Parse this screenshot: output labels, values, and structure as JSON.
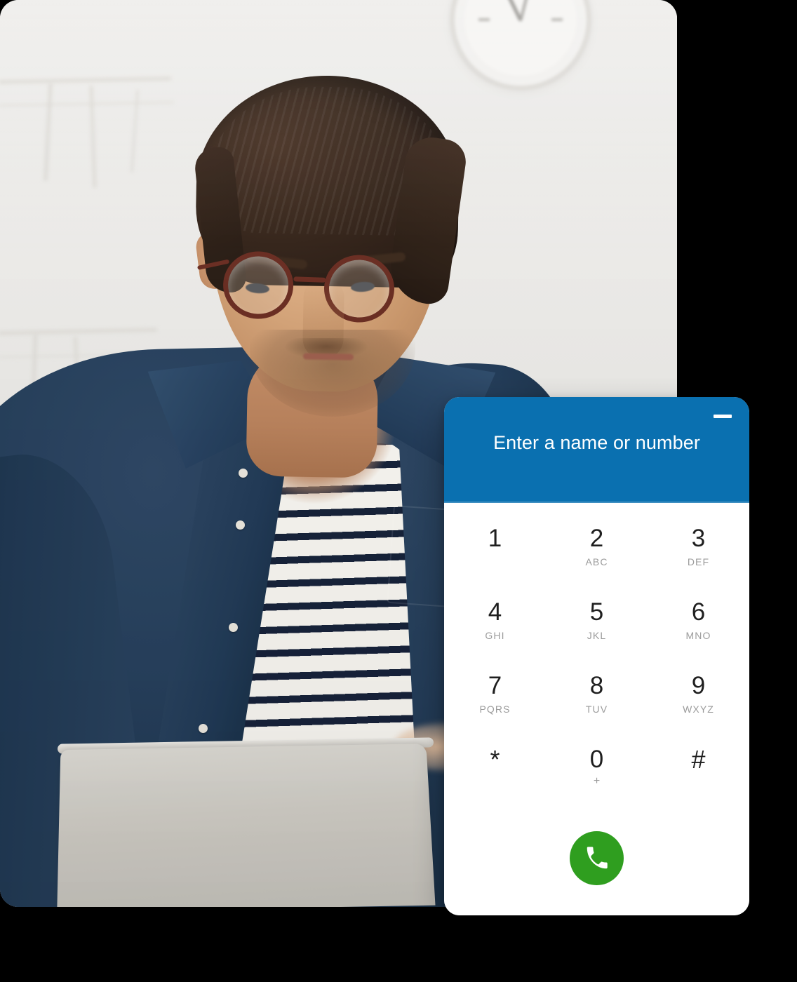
{
  "photo": {
    "alt_description": "Man with glasses in denim shirt and striped t-shirt working at a laptop",
    "background_clock": "wall-clock"
  },
  "dialpad": {
    "header": {
      "title": "Enter a name or number",
      "minimize_label": "Minimize",
      "bg_color": "#0a70b0",
      "text_color": "#ffffff"
    },
    "keys": [
      {
        "digit": "1",
        "letters": ""
      },
      {
        "digit": "2",
        "letters": "ABC"
      },
      {
        "digit": "3",
        "letters": "DEF"
      },
      {
        "digit": "4",
        "letters": "GHI"
      },
      {
        "digit": "5",
        "letters": "JKL"
      },
      {
        "digit": "6",
        "letters": "MNO"
      },
      {
        "digit": "7",
        "letters": "PQRS"
      },
      {
        "digit": "8",
        "letters": "TUV"
      },
      {
        "digit": "9",
        "letters": "WXYZ"
      },
      {
        "digit": "*",
        "letters": ""
      },
      {
        "digit": "0",
        "letters": "+"
      },
      {
        "digit": "#",
        "letters": ""
      }
    ],
    "call_button": {
      "label": "Call",
      "icon": "phone-handset-icon",
      "color": "#2f9e1f"
    }
  }
}
